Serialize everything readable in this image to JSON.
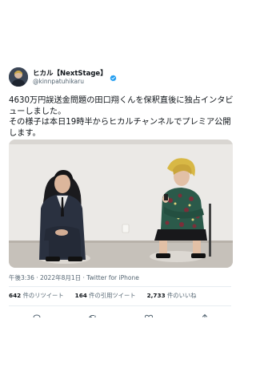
{
  "account": {
    "display_name": "ヒカル【NextStage】",
    "handle": "@kinnpatuhikaru",
    "verified": true
  },
  "tweet": {
    "text": "4630万円誤送金問題の田口翔くんを保釈直後に独占インタビューしました。\nその様子は本日19時半からヒカルチャンネルでプレミア公開します。"
  },
  "meta": {
    "time": "午後3:36",
    "separator": " · ",
    "date": "2022年8月1日",
    "client": "Twitter for iPhone"
  },
  "stats": {
    "retweets_count": "642",
    "retweets_label": "件のリツイート",
    "quotes_count": "164",
    "quotes_label": "件の引用ツイート",
    "likes_count": "2,733",
    "likes_label": "件のいいね"
  },
  "colors": {
    "text": "#0f1419",
    "secondary": "#536471",
    "verified": "#1d9bf0",
    "divider": "#e6ecf0"
  },
  "icons": [
    "verified-badge-icon",
    "reply-icon",
    "retweet-icon",
    "like-icon",
    "share-icon"
  ]
}
